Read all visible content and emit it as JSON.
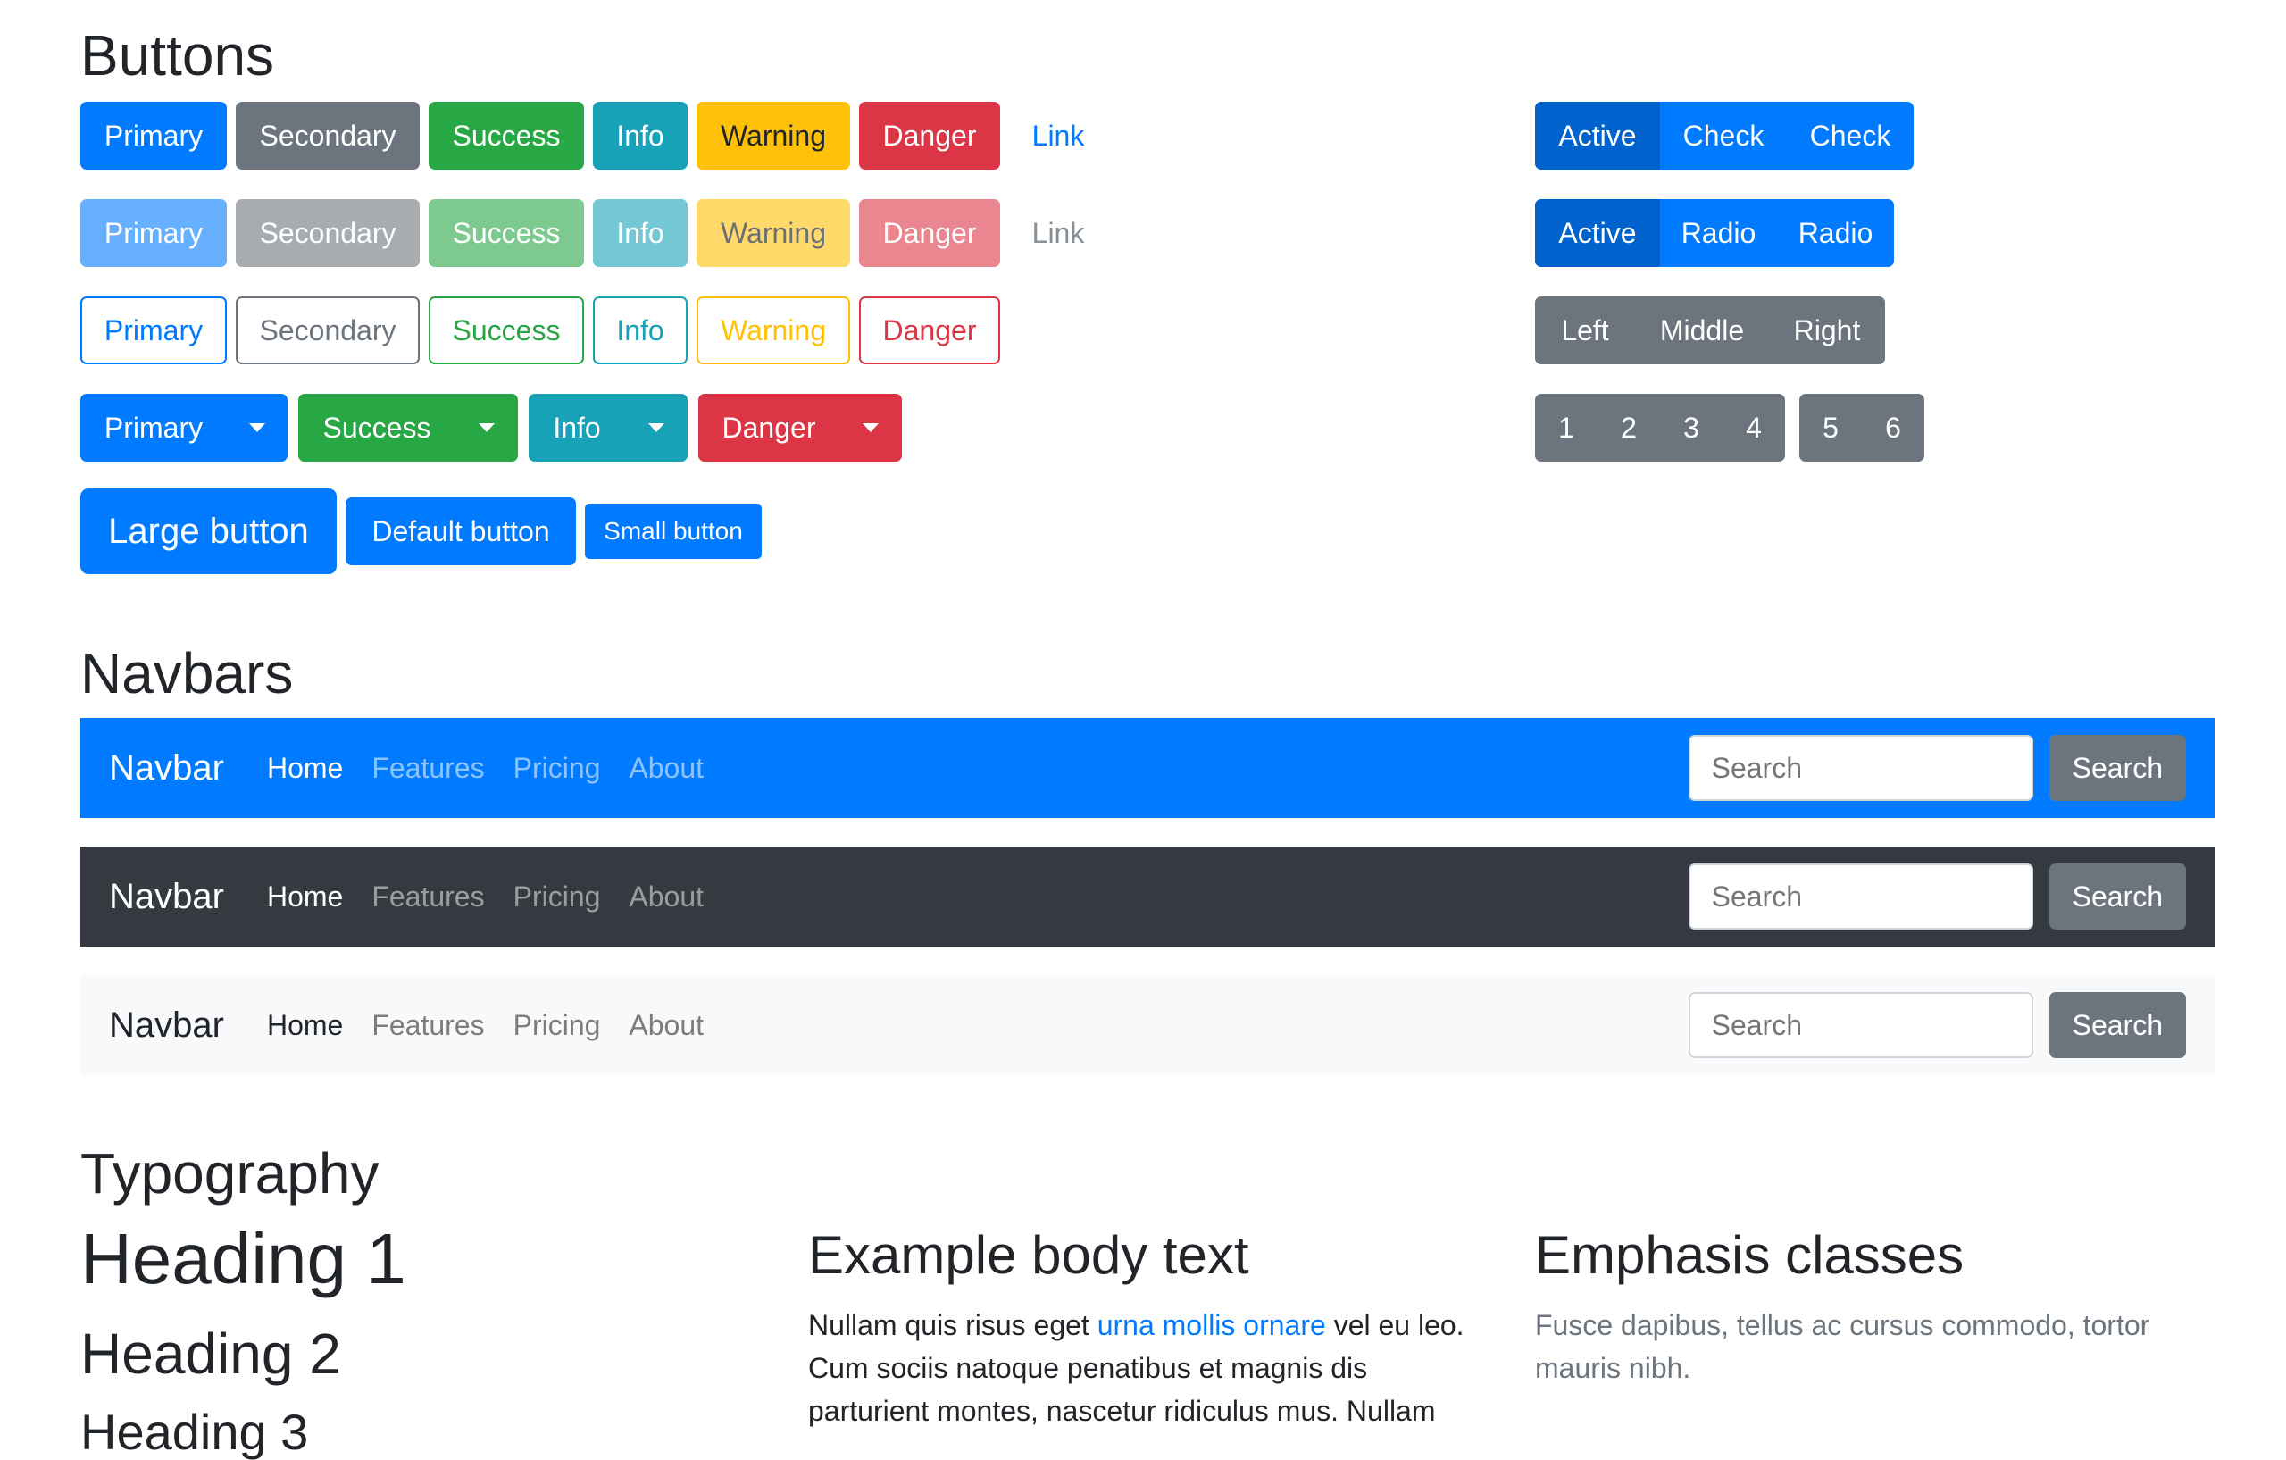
{
  "sections": {
    "buttons": "Buttons",
    "navbars": "Navbars",
    "typography": "Typography"
  },
  "buttons": {
    "solid": [
      "Primary",
      "Secondary",
      "Success",
      "Info",
      "Warning",
      "Danger",
      "Link"
    ],
    "disabled": [
      "Primary",
      "Secondary",
      "Success",
      "Info",
      "Warning",
      "Danger",
      "Link"
    ],
    "outline": [
      "Primary",
      "Secondary",
      "Success",
      "Info",
      "Warning",
      "Danger"
    ],
    "split": [
      "Primary",
      "Success",
      "Info",
      "Danger"
    ],
    "sizes": [
      "Large button",
      "Default button",
      "Small button"
    ]
  },
  "button_groups": {
    "checkbox": [
      "Active",
      "Check",
      "Check"
    ],
    "radio": [
      "Active",
      "Radio",
      "Radio"
    ],
    "alignment": [
      "Left",
      "Middle",
      "Right"
    ],
    "pager_a": [
      "1",
      "2",
      "3",
      "4"
    ],
    "pager_b": [
      "5",
      "6"
    ]
  },
  "navbar": {
    "brand": "Navbar",
    "links": [
      "Home",
      "Features",
      "Pricing",
      "About"
    ],
    "search_placeholder": "Search",
    "search_button": "Search"
  },
  "typography": {
    "h1": "Heading 1",
    "h2": "Heading 2",
    "h3": "Heading 3",
    "body_title": "Example body text",
    "body_pre": "Nullam quis risus eget ",
    "body_link": "urna mollis ornare",
    "body_post": " vel eu leo. Cum sociis natoque penatibus et magnis dis parturient montes, nascetur ridiculus mus. Nullam",
    "emphasis_title": "Emphasis classes",
    "emphasis_muted": "Fusce dapibus, tellus ac cursus commodo, tortor mauris nibh."
  },
  "colors": {
    "primary": "#007bff",
    "secondary": "#6c757d",
    "success": "#28a745",
    "info": "#17a2b8",
    "warning": "#ffc107",
    "danger": "#dc3545",
    "dark": "#343a40",
    "light": "#f8f9fa"
  }
}
